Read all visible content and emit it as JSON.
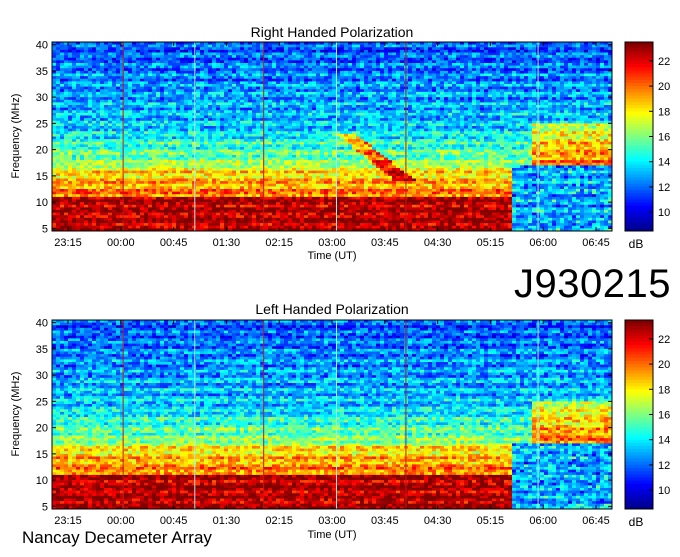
{
  "chart_data": [
    {
      "type": "heatmap",
      "title": "Right Handed Polarization",
      "xlabel": "Time (UT)",
      "ylabel": "Frequency (MHz)",
      "x_ticks": [
        "23:15",
        "00:00",
        "00:45",
        "01:30",
        "02:15",
        "03:00",
        "03:45",
        "04:30",
        "05:15",
        "06:00",
        "06:45"
      ],
      "y_ticks": [
        5,
        10,
        15,
        20,
        25,
        30,
        35,
        40
      ],
      "ylim": [
        4.5,
        40.5
      ],
      "colorbar": {
        "label": "dB",
        "ticks": [
          10,
          12,
          14,
          16,
          18,
          20,
          22
        ],
        "range": [
          8.5,
          23.5
        ]
      }
    },
    {
      "type": "heatmap",
      "title": "Left Handed Polarization",
      "xlabel": "Time (UT)",
      "ylabel": "Frequency (MHz)",
      "x_ticks": [
        "23:15",
        "00:00",
        "00:45",
        "01:30",
        "02:15",
        "03:00",
        "03:45",
        "04:30",
        "05:15",
        "06:00",
        "06:45"
      ],
      "y_ticks": [
        5,
        10,
        15,
        20,
        25,
        30,
        35,
        40
      ],
      "ylim": [
        4.5,
        40.5
      ],
      "colorbar": {
        "label": "dB",
        "ticks": [
          10,
          12,
          14,
          16,
          18,
          20,
          22
        ],
        "range": [
          8.5,
          23.5
        ]
      }
    }
  ],
  "observation_id": "J930215",
  "instrument": "Nancay Decameter Array",
  "colors": {
    "colormap": [
      "#00008f",
      "#0000ff",
      "#0080ff",
      "#00ffff",
      "#80ff80",
      "#ffff00",
      "#ff8000",
      "#ff0000",
      "#800000"
    ],
    "vertical_red_lines": "#c01818",
    "vertical_cyan_lines": "#a8f0f0"
  }
}
